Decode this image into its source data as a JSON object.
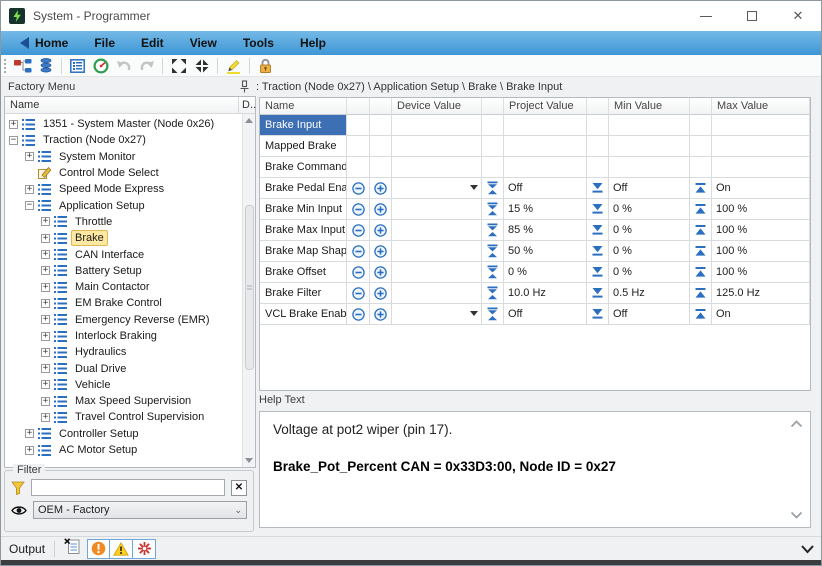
{
  "window": {
    "title": "System - Programmer"
  },
  "menubar": {
    "items": [
      "Home",
      "File",
      "Edit",
      "View",
      "Tools",
      "Help"
    ]
  },
  "toolbar": {
    "icons": [
      "hierarchy",
      "layers",
      "form-view",
      "gauge",
      "undo",
      "redo",
      "expand-all",
      "collapse-all",
      "highlighter",
      "lock"
    ]
  },
  "breadcrumb": ": Traction (Node 0x27) \\ Application Setup \\ Brake \\ Brake Input",
  "left_panel": {
    "title": "Factory Menu",
    "tree": {
      "columns": {
        "name": "Name",
        "desc": "D.."
      },
      "items": [
        {
          "label": "1351 - System Master (Node 0x26)",
          "level": 0,
          "expander": "plus",
          "icon": "list"
        },
        {
          "label": "Traction (Node 0x27)",
          "level": 0,
          "expander": "minus",
          "icon": "list"
        },
        {
          "label": "System Monitor",
          "level": 1,
          "expander": "plus",
          "icon": "list"
        },
        {
          "label": "Control Mode Select",
          "level": 1,
          "expander": "none",
          "icon": "edit"
        },
        {
          "label": "Speed Mode Express",
          "level": 1,
          "expander": "plus",
          "icon": "list"
        },
        {
          "label": "Application Setup",
          "level": 1,
          "expander": "minus",
          "icon": "list"
        },
        {
          "label": "Throttle",
          "level": 2,
          "expander": "plus",
          "icon": "list"
        },
        {
          "label": "Brake",
          "level": 2,
          "expander": "plus",
          "icon": "list",
          "selected": true
        },
        {
          "label": "CAN Interface",
          "level": 2,
          "expander": "plus",
          "icon": "list"
        },
        {
          "label": "Battery Setup",
          "level": 2,
          "expander": "plus",
          "icon": "list"
        },
        {
          "label": "Main Contactor",
          "level": 2,
          "expander": "plus",
          "icon": "list"
        },
        {
          "label": "EM Brake Control",
          "level": 2,
          "expander": "plus",
          "icon": "list"
        },
        {
          "label": "Emergency Reverse (EMR)",
          "level": 2,
          "expander": "plus",
          "icon": "list"
        },
        {
          "label": "Interlock Braking",
          "level": 2,
          "expander": "plus",
          "icon": "list"
        },
        {
          "label": "Hydraulics",
          "level": 2,
          "expander": "plus",
          "icon": "list"
        },
        {
          "label": "Dual Drive",
          "level": 2,
          "expander": "plus",
          "icon": "list"
        },
        {
          "label": "Vehicle",
          "level": 2,
          "expander": "plus",
          "icon": "list"
        },
        {
          "label": "Max Speed Supervision",
          "level": 2,
          "expander": "plus",
          "icon": "list"
        },
        {
          "label": "Travel Control Supervision",
          "level": 2,
          "expander": "plus",
          "icon": "list"
        },
        {
          "label": "Controller Setup",
          "level": 1,
          "expander": "plus",
          "icon": "list"
        },
        {
          "label": "AC Motor Setup",
          "level": 1,
          "expander": "plus",
          "icon": "list"
        }
      ]
    },
    "filter": {
      "legend": "Filter",
      "input_value": "",
      "clear_glyph": "✕"
    },
    "view_select": {
      "value": "OEM - Factory"
    }
  },
  "table": {
    "columns": [
      "Name",
      "",
      "",
      "Device Value",
      "",
      "Project Value",
      "",
      "Min Value",
      "",
      "Max Value"
    ],
    "rows": [
      {
        "name": "Brake Input",
        "editable": false,
        "selected": true
      },
      {
        "name": "Mapped Brake",
        "editable": false
      },
      {
        "name": "Brake Command",
        "editable": false
      },
      {
        "name": "Brake Pedal Enable",
        "editable": true,
        "dropdown": true,
        "device": "",
        "project": "Off",
        "min": "Off",
        "max": "On"
      },
      {
        "name": "Brake Min Input",
        "editable": true,
        "device": "",
        "project": "15 %",
        "min": "0 %",
        "max": "100 %"
      },
      {
        "name": "Brake Max Input",
        "editable": true,
        "device": "",
        "project": "85 %",
        "min": "0 %",
        "max": "100 %"
      },
      {
        "name": "Brake Map Shape",
        "editable": true,
        "device": "",
        "project": "50 %",
        "min": "0 %",
        "max": "100 %"
      },
      {
        "name": "Brake Offset",
        "editable": true,
        "device": "",
        "project": "0 %",
        "min": "0 %",
        "max": "100 %"
      },
      {
        "name": "Brake Filter",
        "editable": true,
        "device": "",
        "project": "10.0 Hz",
        "min": "0.5 Hz",
        "max": "125.0 Hz"
      },
      {
        "name": "VCL Brake Enable",
        "editable": true,
        "dropdown": true,
        "device": "",
        "project": "Off",
        "min": "Off",
        "max": "On"
      }
    ]
  },
  "help": {
    "label": "Help Text",
    "line1": "Voltage at pot2 wiper (pin 17).",
    "line2": "Brake_Pot_Percent CAN = 0x33D3:00, Node ID = 0x27"
  },
  "output_bar": {
    "label": "Output"
  },
  "colors": {
    "menubar_blue": "#3e97d5",
    "selection_blue": "#3d6fb5",
    "tree_selection_yellow": "#fde9a2",
    "icon_blue": "#2b6fc0",
    "warning_yellow": "#ffce1f",
    "info_orange": "#f08a24",
    "error_red": "#c9302c"
  }
}
